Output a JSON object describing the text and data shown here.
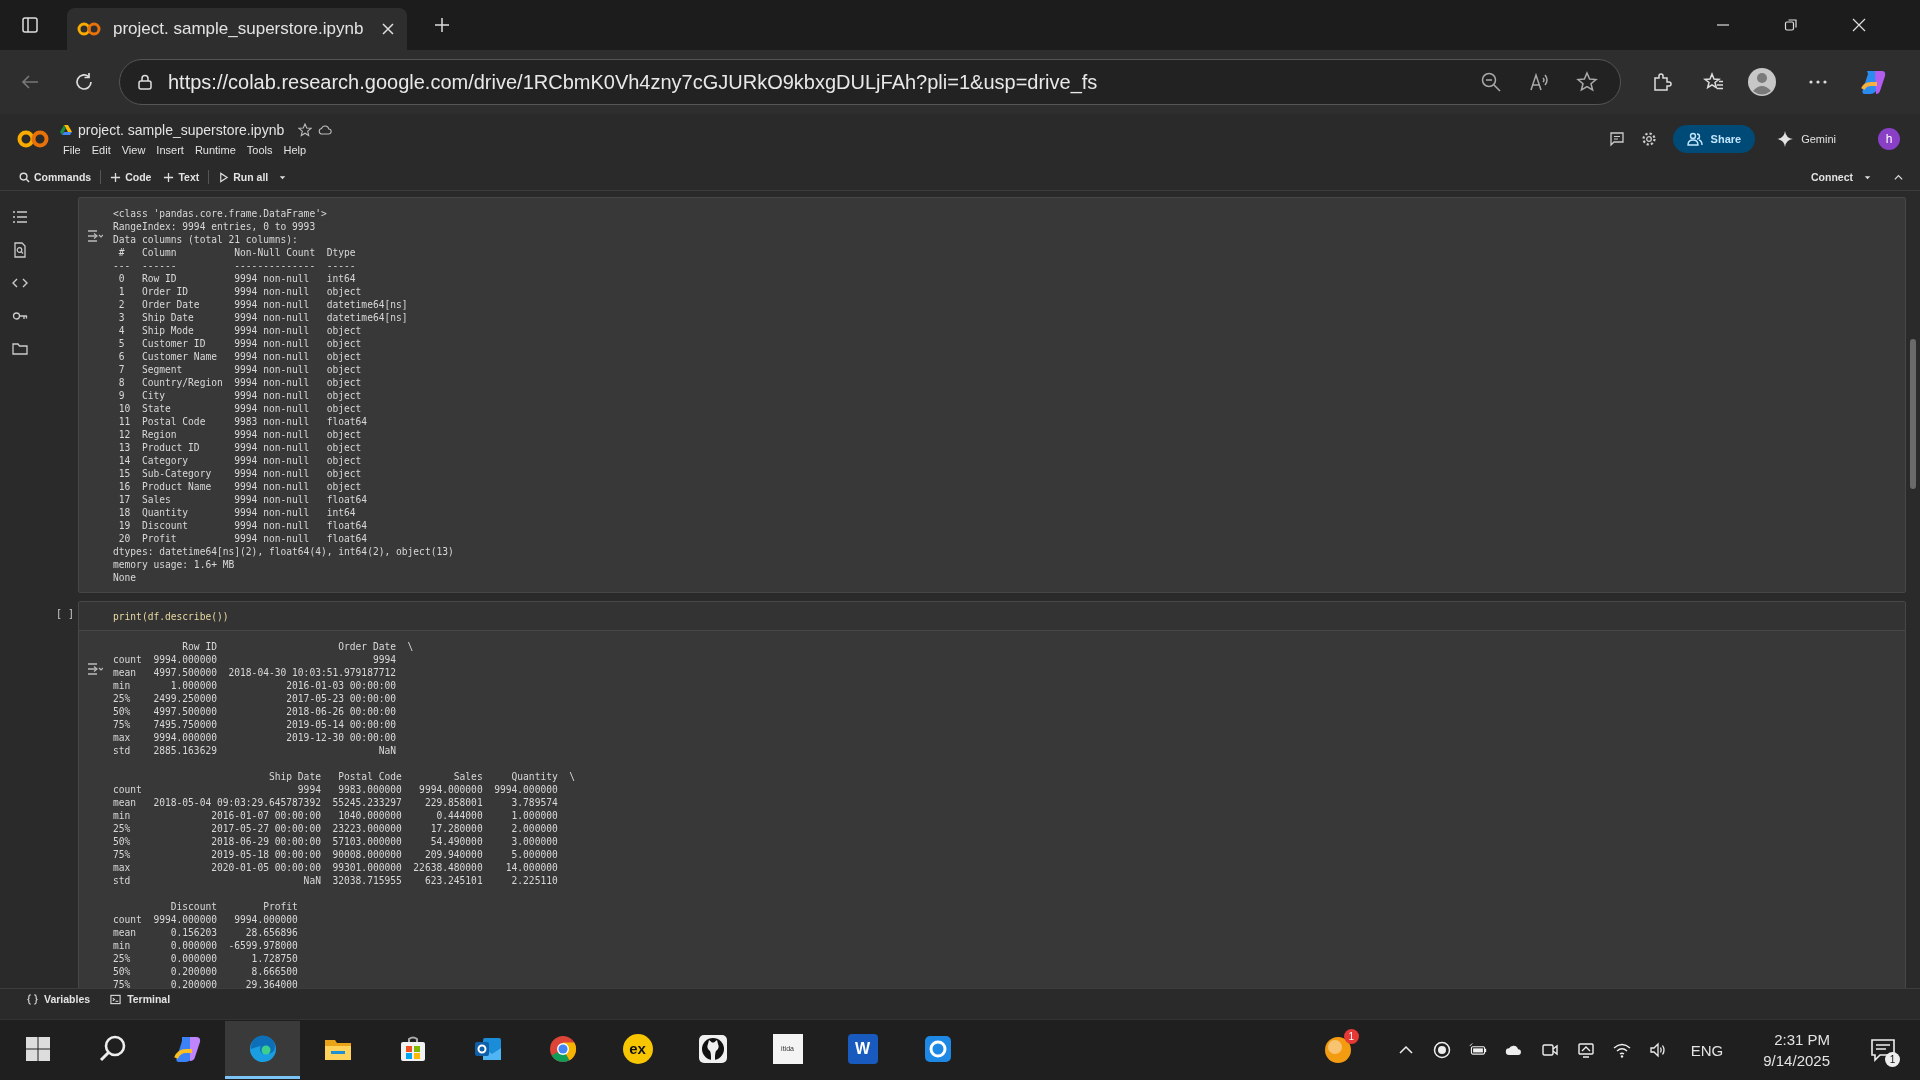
{
  "browser": {
    "tab_title": "project. sample_superstore.ipynb",
    "url": "https://colab.research.google.com/drive/1RCbmK0Vh4zny7cGJURkO9kbxgDULjFAh?pli=1&usp=drive_fs"
  },
  "colab": {
    "file_name": "project. sample_superstore.ipynb",
    "menu": [
      "File",
      "Edit",
      "View",
      "Insert",
      "Runtime",
      "Tools",
      "Help"
    ],
    "share": "Share",
    "gemini": "Gemini",
    "avatar": "h",
    "toolbar": [
      {
        "kind": "search",
        "label": "Commands"
      },
      {
        "kind": "add",
        "label": "Code"
      },
      {
        "kind": "add",
        "label": "Text"
      },
      {
        "kind": "run",
        "label": "Run all"
      }
    ],
    "connect": "Connect"
  },
  "cells": [
    {
      "output_blocks": [
        {
          "lines": [
            "<class 'pandas.core.frame.DataFrame'>",
            "RangeIndex: 9994 entries, 0 to 9993",
            "Data columns (total 21 columns):",
            " #   Column          Non-Null Count  Dtype",
            "---  ------          --------------  -----",
            " 0   Row ID          9994 non-null   int64",
            " 1   Order ID        9994 non-null   object",
            " 2   Order Date      9994 non-null   datetime64[ns]",
            " 3   Ship Date       9994 non-null   datetime64[ns]",
            " 4   Ship Mode       9994 non-null   object",
            " 5   Customer ID     9994 non-null   object",
            " 6   Customer Name   9994 non-null   object",
            " 7   Segment         9994 non-null   object",
            " 8   Country/Region  9994 non-null   object",
            " 9   City            9994 non-null   object",
            " 10  State           9994 non-null   object",
            " 11  Postal Code     9983 non-null   float64",
            " 12  Region          9994 non-null   object",
            " 13  Product ID      9994 non-null   object",
            " 14  Category        9994 non-null   object",
            " 15  Sub-Category    9994 non-null   object",
            " 16  Product Name    9994 non-null   object",
            " 17  Sales           9994 non-null   float64",
            " 18  Quantity        9994 non-null   int64",
            " 19  Discount        9994 non-null   float64",
            " 20  Profit          9994 non-null   float64",
            "dtypes: datetime64[ns](2), float64(4), int64(2), object(13)",
            "memory usage: 1.6+ MB",
            "None"
          ]
        }
      ]
    },
    {
      "run_label": "[ ]",
      "code": "print(df.describe())",
      "output_blocks": [
        {
          "lines": [
            "            Row ID                     Order Date  \\",
            "count  9994.000000                           9994",
            "mean   4997.500000  2018-04-30 10:03:51.979187712",
            "min       1.000000            2016-01-03 00:00:00",
            "25%    2499.250000            2017-05-23 00:00:00",
            "50%    4997.500000            2018-06-26 00:00:00",
            "75%    7495.750000            2019-05-14 00:00:00",
            "max    9994.000000            2019-12-30 00:00:00",
            "std    2885.163629                            NaN"
          ]
        },
        {
          "lines": [
            "                           Ship Date   Postal Code         Sales     Quantity  \\",
            "count                           9994   9983.000000   9994.000000  9994.000000",
            "mean   2018-05-04 09:03:29.645787392  55245.233297    229.858001     3.789574",
            "min              2016-01-07 00:00:00   1040.000000      0.444000     1.000000",
            "25%              2017-05-27 00:00:00  23223.000000     17.280000     2.000000",
            "50%              2018-06-29 00:00:00  57103.000000     54.490000     3.000000",
            "75%              2019-05-18 00:00:00  90008.000000    209.940000     5.000000",
            "max              2020-01-05 00:00:00  99301.000000  22638.480000    14.000000",
            "std                              NaN  32038.715955    623.245101     2.225110"
          ]
        },
        {
          "lines": [
            "          Discount        Profit",
            "count  9994.000000   9994.000000",
            "mean      0.156203     28.656896",
            "min       0.000000  -6599.978000",
            "25%       0.000000      1.728750",
            "50%       0.200000      8.666500",
            "75%       0.200000     29.364000"
          ]
        }
      ]
    }
  ],
  "bottom_bar": [
    "Variables",
    "Terminal"
  ],
  "taskbar": {
    "apps": [
      {
        "kind": "start",
        "selected": false
      },
      {
        "kind": "search",
        "selected": false
      },
      {
        "kind": "copilot",
        "selected": false
      },
      {
        "kind": "edge",
        "selected": true
      },
      {
        "kind": "explorer",
        "selected": false
      },
      {
        "kind": "store",
        "selected": false
      },
      {
        "kind": "outlook",
        "selected": false
      },
      {
        "kind": "chrome",
        "selected": false
      },
      {
        "kind": "ex",
        "label": "ex",
        "selected": false
      },
      {
        "kind": "github",
        "selected": false
      },
      {
        "kind": "itida",
        "label": "itida",
        "selected": false
      },
      {
        "kind": "word",
        "label": "W",
        "selected": false
      },
      {
        "kind": "app",
        "selected": false
      }
    ],
    "tray_badge": "1",
    "language": "ENG",
    "time": "2:31 PM",
    "date": "9/14/2025",
    "notification_count": "1"
  }
}
